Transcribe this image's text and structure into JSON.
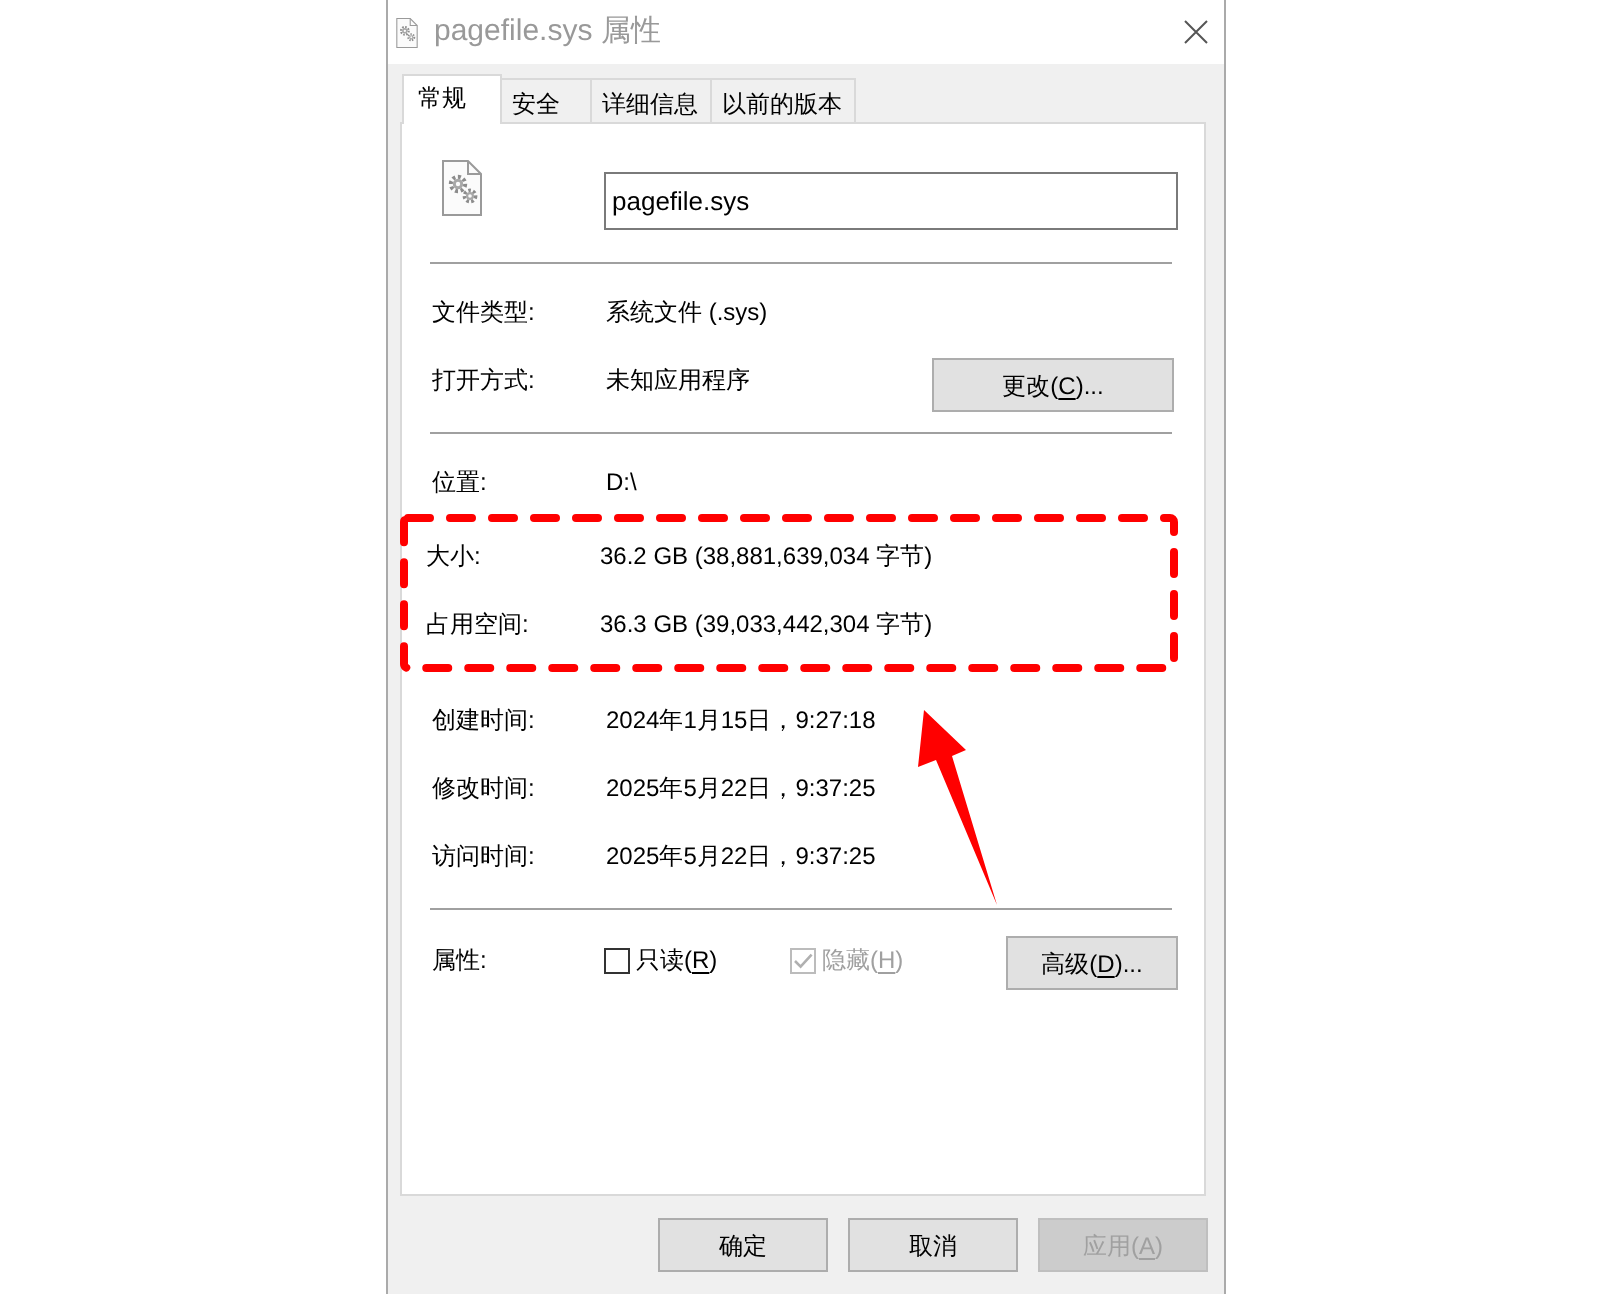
{
  "window": {
    "title": "pagefile.sys 属性"
  },
  "tabs": [
    {
      "label": "常规",
      "selected": true
    },
    {
      "label": "安全",
      "selected": false
    },
    {
      "label": "详细信息",
      "selected": false
    },
    {
      "label": "以前的版本",
      "selected": false
    }
  ],
  "name_field": {
    "value": "pagefile.sys"
  },
  "sections": [
    {
      "rows": [
        {
          "label": "文件类型:",
          "value": "系统文件 (.sys)",
          "highlighted": false
        },
        {
          "label": "打开方式:",
          "value": "未知应用程序",
          "highlighted": false,
          "button": {
            "text_before": "更改(",
            "mnemonic": "C",
            "text_after": ")..."
          }
        }
      ]
    },
    {
      "rows": [
        {
          "label": "位置:",
          "value": "D:\\",
          "highlighted": false
        },
        {
          "label": "大小:",
          "value": "36.2 GB (38,881,639,034 字节)",
          "highlighted": true
        },
        {
          "label": "占用空间:",
          "value": "36.3 GB (39,033,442,304 字节)",
          "highlighted": true
        },
        {
          "label": "创建时间:",
          "value": "2024年1月15日，9:27:18",
          "highlighted": false
        },
        {
          "label": "修改时间:",
          "value": "2025年5月22日，9:37:25",
          "highlighted": false
        },
        {
          "label": "访问时间:",
          "value": "2025年5月22日，9:37:25",
          "highlighted": false
        }
      ]
    }
  ],
  "attributes": {
    "label": "属性:",
    "checkboxes": [
      {
        "text_before": "只读(",
        "mnemonic": "R",
        "text_after": ")",
        "checked": false,
        "disabled": false
      },
      {
        "text_before": "隐藏(",
        "mnemonic": "H",
        "text_after": ")",
        "checked": true,
        "disabled": true
      }
    ],
    "button": {
      "text_before": "高级(",
      "mnemonic": "D",
      "text_after": ")..."
    }
  },
  "buttons": [
    {
      "text_before": "确定",
      "disabled": false
    },
    {
      "text_before": "取消",
      "disabled": false
    },
    {
      "text_before": "应用(",
      "mnemonic": "A",
      "text_after": ")",
      "disabled": true
    }
  ]
}
